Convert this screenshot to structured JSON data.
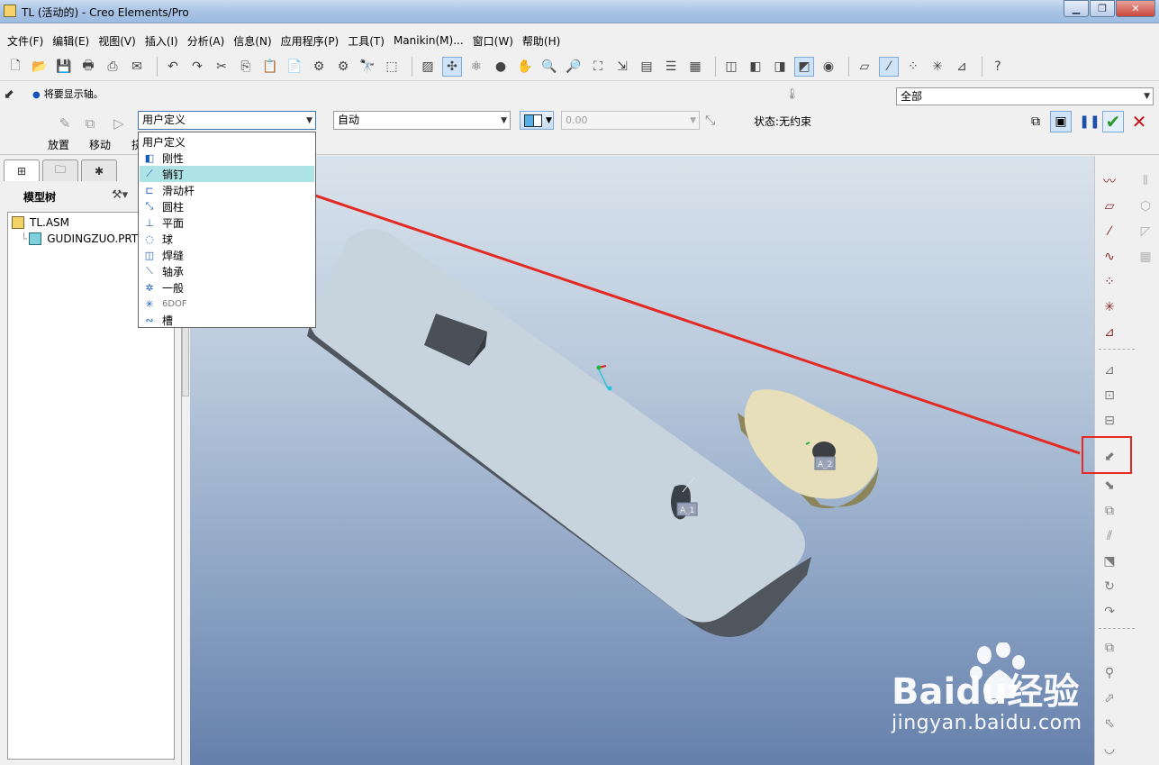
{
  "window": {
    "title": "TL (活动的) - Creo Elements/Pro",
    "controls": [
      "minimize-icon",
      "restore-icon",
      "close-icon"
    ]
  },
  "menu": [
    "文件(F)",
    "编辑(E)",
    "视图(V)",
    "插入(I)",
    "分析(A)",
    "信息(N)",
    "应用程序(P)",
    "工具(T)",
    "Manikin(M)...",
    "窗口(W)",
    "帮助(H)"
  ],
  "toolbar_icons": [
    "new-icon",
    "open-icon",
    "save-icon",
    "print-icon",
    "send-icon",
    "send-mail-icon",
    "undo-icon",
    "redo-icon",
    "cut-icon",
    "copy-icon",
    "paste-icon",
    "paste-special-icon",
    "regenerate-icon",
    "regenerate-manager-icon",
    "find-icon",
    "select-box-icon",
    "repaint-icon",
    "spin-center-icon",
    "orient-icon",
    "shading-icon",
    "pan-icon",
    "zoom-in-icon",
    "zoom-out-icon",
    "refit-icon",
    "reorient-icon",
    "saved-views-icon",
    "layers-icon",
    "view-manager-icon",
    "wireframe-icon",
    "hidden-line-icon",
    "no-hidden-icon",
    "shaded-icon",
    "appearance-icon",
    "datum-planes-icon",
    "datum-axes-icon",
    "datum-points-icon",
    "coord-sys-icon",
    "annotation-icon",
    "help-icon"
  ],
  "dashboard": {
    "message": "将要显示轴。",
    "filter_value": "全部",
    "constraint_set_value": "用户定义",
    "constraint_type_value": "自动",
    "offset_value": "0.00",
    "status": "状态:无约束",
    "tabs": [
      "放置",
      "移动",
      "挠"
    ]
  },
  "dropdown": {
    "items": [
      {
        "label": "用户定义",
        "icon": ""
      },
      {
        "label": "刚性",
        "icon": "rigid-icon"
      },
      {
        "label": "销钉",
        "icon": "pin-icon"
      },
      {
        "label": "滑动杆",
        "icon": "slider-icon"
      },
      {
        "label": "圆柱",
        "icon": "cylinder-icon"
      },
      {
        "label": "平面",
        "icon": "planar-icon"
      },
      {
        "label": "球",
        "icon": "ball-icon"
      },
      {
        "label": "焊缝",
        "icon": "weld-icon"
      },
      {
        "label": "轴承",
        "icon": "bearing-icon"
      },
      {
        "label": "一般",
        "icon": "general-icon"
      },
      {
        "label": "6DOF",
        "icon": "6dof-icon"
      },
      {
        "label": "槽",
        "icon": "slot-icon"
      }
    ],
    "highlighted_index": 2
  },
  "model_tree": {
    "title": "模型树",
    "nodes": [
      {
        "label": "TL.ASM",
        "icon": "assembly-icon"
      },
      {
        "label": "GUDINGZUO.PRT",
        "icon": "part-icon"
      }
    ]
  },
  "viewport_labels": {
    "axis_tag_1": "A_1",
    "axis_tag_2": "A_2"
  },
  "watermark": {
    "brand": "Baidu经验",
    "url": "jingyan.baidu.com"
  },
  "colors": {
    "annotation_red": "#e42a22",
    "dropdown_highlight": "#aee3e6",
    "ok_green": "#2a9a2a",
    "cancel_red": "#c0161b",
    "plate_top": "#c9d5de",
    "cam_top": "#e6dfba"
  }
}
